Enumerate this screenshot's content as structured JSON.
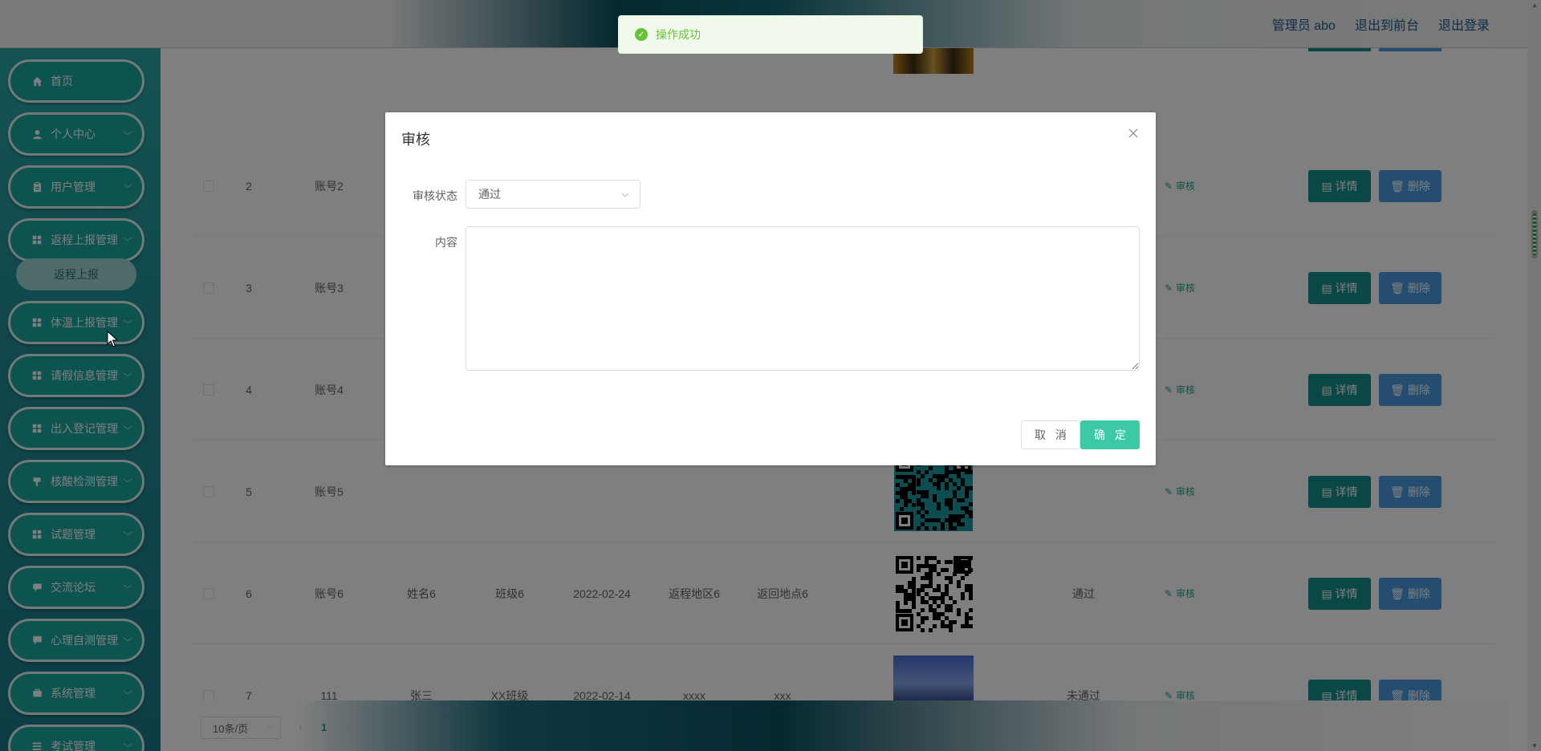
{
  "header": {
    "admin_label": "管理员 abo",
    "to_front_label": "退出到前台",
    "logout_label": "退出登录"
  },
  "sidebar": {
    "items": [
      {
        "label": "首页",
        "icon": "home-icon"
      },
      {
        "label": "个人中心",
        "icon": "user-icon"
      },
      {
        "label": "用户管理",
        "icon": "clipboard-icon"
      },
      {
        "label": "返程上报管理",
        "icon": "grid-icon"
      },
      {
        "label": "体温上报管理",
        "icon": "grid-icon"
      },
      {
        "label": "请假信息管理",
        "icon": "grid-icon"
      },
      {
        "label": "出入登记管理",
        "icon": "grid-icon"
      },
      {
        "label": "核酸检测管理",
        "icon": "brush-icon"
      },
      {
        "label": "试题管理",
        "icon": "grid-icon"
      },
      {
        "label": "交流论坛",
        "icon": "chat-icon"
      },
      {
        "label": "心理自测管理",
        "icon": "message-icon"
      },
      {
        "label": "系统管理",
        "icon": "briefcase-icon"
      },
      {
        "label": "考试管理",
        "icon": "list-icon"
      }
    ],
    "sub_item": "返程上报"
  },
  "table": {
    "rows": [
      {
        "index": "2",
        "account": "账号2",
        "name": "",
        "class": "",
        "date": "",
        "from": "",
        "to": "",
        "image": "qr",
        "status": ""
      },
      {
        "index": "3",
        "account": "账号3",
        "name": "",
        "class": "",
        "date": "",
        "from": "",
        "to": "",
        "image": "none",
        "status": ""
      },
      {
        "index": "4",
        "account": "账号4",
        "name": "",
        "class": "",
        "date": "",
        "from": "",
        "to": "",
        "image": "none",
        "status": ""
      },
      {
        "index": "5",
        "account": "账号5",
        "name": "",
        "class": "",
        "date": "",
        "from": "",
        "to": "",
        "image": "qr-teal",
        "status": ""
      },
      {
        "index": "6",
        "account": "账号6",
        "name": "姓名6",
        "class": "班级6",
        "date": "2022-02-24",
        "from": "返程地区6",
        "to": "返回地点6",
        "image": "qr",
        "status": "通过"
      },
      {
        "index": "7",
        "account": "111",
        "name": "张三",
        "class": "XX班级",
        "date": "2022-02-14",
        "from": "xxxx",
        "to": "xxx",
        "image": "photo",
        "status": "未通过"
      }
    ],
    "audit_label": "审核",
    "detail_label": "详情",
    "delete_label": "删除"
  },
  "pagination": {
    "page_size": "10条/页",
    "current_page": "1"
  },
  "dialog": {
    "title": "审核",
    "status_label": "审核状态",
    "status_value": "通过",
    "content_label": "内容",
    "content_value": "",
    "cancel_label": "取 消",
    "ok_label": "确 定"
  },
  "toast": {
    "message": "操作成功"
  }
}
